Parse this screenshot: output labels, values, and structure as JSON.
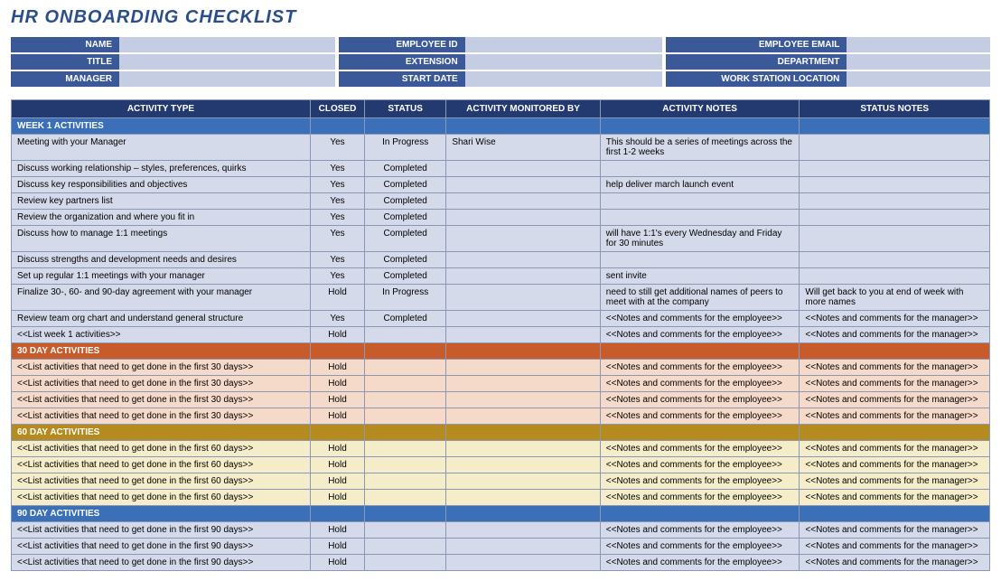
{
  "title": "HR ONBOARDING CHECKLIST",
  "info": {
    "col1": [
      {
        "label": "NAME",
        "value": ""
      },
      {
        "label": "TITLE",
        "value": ""
      },
      {
        "label": "MANAGER",
        "value": ""
      }
    ],
    "col2": [
      {
        "label": "EMPLOYEE ID",
        "value": ""
      },
      {
        "label": "EXTENSION",
        "value": ""
      },
      {
        "label": "START DATE",
        "value": ""
      }
    ],
    "col3": [
      {
        "label": "EMPLOYEE EMAIL",
        "value": ""
      },
      {
        "label": "DEPARTMENT",
        "value": ""
      },
      {
        "label": "WORK STATION LOCATION",
        "value": ""
      }
    ]
  },
  "columns": [
    "ACTIVITY TYPE",
    "CLOSED",
    "STATUS",
    "ACTIVITY MONITORED BY",
    "ACTIVITY NOTES",
    "STATUS NOTES"
  ],
  "sections": [
    {
      "title": "WEEK 1 ACTIVITIES",
      "class": "week1",
      "rows": [
        {
          "activity": "Meeting with your Manager",
          "closed": "Yes",
          "status": "In Progress",
          "monitored": "Shari Wise",
          "notes": "This should be a series of meetings across the first 1-2 weeks",
          "statusnotes": ""
        },
        {
          "activity": "Discuss working relationship – styles, preferences, quirks",
          "closed": "Yes",
          "status": "Completed",
          "monitored": "",
          "notes": "",
          "statusnotes": ""
        },
        {
          "activity": "Discuss key responsibilities and objectives",
          "closed": "Yes",
          "status": "Completed",
          "monitored": "",
          "notes": "help deliver march launch event",
          "statusnotes": ""
        },
        {
          "activity": "Review key partners list",
          "closed": "Yes",
          "status": "Completed",
          "monitored": "",
          "notes": "",
          "statusnotes": ""
        },
        {
          "activity": "Review the organization and where you fit in",
          "closed": "Yes",
          "status": "Completed",
          "monitored": "",
          "notes": "",
          "statusnotes": ""
        },
        {
          "activity": "Discuss how to manage 1:1 meetings",
          "closed": "Yes",
          "status": "Completed",
          "monitored": "",
          "notes": "will have 1:1's every Wednesday and Friday for 30 minutes",
          "statusnotes": ""
        },
        {
          "activity": "Discuss strengths and development needs and desires",
          "closed": "Yes",
          "status": "Completed",
          "monitored": "",
          "notes": "",
          "statusnotes": ""
        },
        {
          "activity": "Set up regular 1:1 meetings with your manager",
          "closed": "Yes",
          "status": "Completed",
          "monitored": "",
          "notes": "sent invite",
          "statusnotes": ""
        },
        {
          "activity": "Finalize 30-, 60- and 90-day agreement with your manager",
          "closed": "Hold",
          "status": "In Progress",
          "monitored": "",
          "notes": "need to still get additional names of peers to meet with at the company",
          "statusnotes": "Will get back to you at end of week with more names"
        },
        {
          "activity": "Review team org chart and understand general structure",
          "closed": "Yes",
          "status": "Completed",
          "monitored": "",
          "notes": "<<Notes and comments for the employee>>",
          "statusnotes": "<<Notes and comments for the manager>>"
        },
        {
          "activity": "<<List week 1 activities>>",
          "closed": "Hold",
          "status": "",
          "monitored": "",
          "notes": "<<Notes and comments for the employee>>",
          "statusnotes": "<<Notes and comments for the manager>>"
        }
      ]
    },
    {
      "title": "30 DAY ACTIVITIES",
      "class": "30",
      "rows": [
        {
          "activity": "<<List activities that need to get done in the first 30 days>>",
          "closed": "Hold",
          "status": "",
          "monitored": "",
          "notes": "<<Notes and comments for the employee>>",
          "statusnotes": "<<Notes and comments for the manager>>"
        },
        {
          "activity": "<<List activities that need to get done in the first 30 days>>",
          "closed": "Hold",
          "status": "",
          "monitored": "",
          "notes": "<<Notes and comments for the employee>>",
          "statusnotes": "<<Notes and comments for the manager>>"
        },
        {
          "activity": "<<List activities that need to get done in the first 30 days>>",
          "closed": "Hold",
          "status": "",
          "monitored": "",
          "notes": "<<Notes and comments for the employee>>",
          "statusnotes": "<<Notes and comments for the manager>>"
        },
        {
          "activity": "<<List activities that need to get done in the first 30 days>>",
          "closed": "Hold",
          "status": "",
          "monitored": "",
          "notes": "<<Notes and comments for the employee>>",
          "statusnotes": "<<Notes and comments for the manager>>"
        }
      ]
    },
    {
      "title": "60 DAY ACTIVITIES",
      "class": "60",
      "rows": [
        {
          "activity": "<<List activities that need to get done in the first 60 days>>",
          "closed": "Hold",
          "status": "",
          "monitored": "",
          "notes": "<<Notes and comments for the employee>>",
          "statusnotes": "<<Notes and comments for the manager>>"
        },
        {
          "activity": "<<List activities that need to get done in the first 60 days>>",
          "closed": "Hold",
          "status": "",
          "monitored": "",
          "notes": "<<Notes and comments for the employee>>",
          "statusnotes": "<<Notes and comments for the manager>>"
        },
        {
          "activity": "<<List activities that need to get done in the first 60 days>>",
          "closed": "Hold",
          "status": "",
          "monitored": "",
          "notes": "<<Notes and comments for the employee>>",
          "statusnotes": "<<Notes and comments for the manager>>"
        },
        {
          "activity": "<<List activities that need to get done in the first 60 days>>",
          "closed": "Hold",
          "status": "",
          "monitored": "",
          "notes": "<<Notes and comments for the employee>>",
          "statusnotes": "<<Notes and comments for the manager>>"
        }
      ]
    },
    {
      "title": "90 DAY ACTIVITIES",
      "class": "90",
      "rows": [
        {
          "activity": "<<List activities that need to get done in the first 90 days>>",
          "closed": "Hold",
          "status": "",
          "monitored": "",
          "notes": "<<Notes and comments for the employee>>",
          "statusnotes": "<<Notes and comments for the manager>>"
        },
        {
          "activity": "<<List activities that need to get done in the first 90 days>>",
          "closed": "Hold",
          "status": "",
          "monitored": "",
          "notes": "<<Notes and comments for the employee>>",
          "statusnotes": "<<Notes and comments for the manager>>"
        },
        {
          "activity": "<<List activities that need to get done in the first 90 days>>",
          "closed": "Hold",
          "status": "",
          "monitored": "",
          "notes": "<<Notes and comments for the employee>>",
          "statusnotes": "<<Notes and comments for the manager>>"
        }
      ]
    }
  ]
}
